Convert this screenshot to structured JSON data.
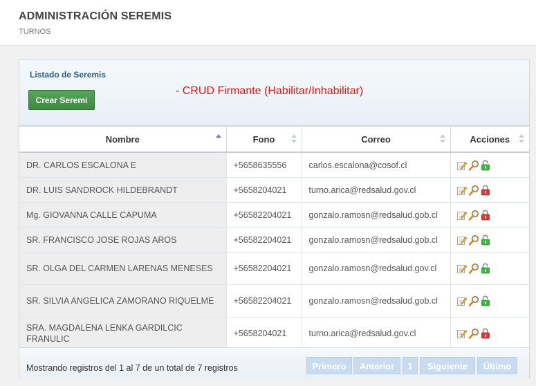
{
  "header": {
    "title": "ADMINISTRACIÓN SEREMIS",
    "subtitle": "TURNOS"
  },
  "panel": {
    "title": "Listado de Seremis",
    "create_button": "Crear Seremi",
    "annotation": "- CRUD Firmante (Habilitar/Inhabilitar)"
  },
  "table": {
    "columns": [
      "Nombre",
      "Fono",
      "Correo",
      "Acciones"
    ],
    "rows": [
      {
        "nombre": "DR. CARLOS ESCALONA E",
        "fono": "+5658635556",
        "correo": "carlos.escalona@cosof.cl",
        "lock": "enabled"
      },
      {
        "nombre": "DR. LUIS SANDROCK HILDEBRANDT",
        "fono": "+5658204021",
        "correo": "turno.arica@redsalud.gov.cl",
        "lock": "disabled"
      },
      {
        "nombre": "Mg. GIOVANNA CALLE CAPUMA",
        "fono": "+56582204021",
        "correo": "gonzalo.ramosn@redsalud.gob.cl",
        "lock": "disabled"
      },
      {
        "nombre": "SR. FRANCISCO JOSE ROJAS AROS",
        "fono": "+56582204021",
        "correo": "gonzalo.ramosn@redsalud.gob.cl",
        "lock": "enabled"
      },
      {
        "nombre": "SR. OLGA DEL CARMEN LARENAS MENESES",
        "fono": "+56582204021",
        "correo": "gonzalo.ramosn@redsalud.gov.cl",
        "lock": "enabled"
      },
      {
        "nombre": "SR. SILVIA ANGELICA ZAMORANO RIQUELME",
        "fono": "+56582204021",
        "correo": "gonzalo.ramosn@redsalud.gob.cl",
        "lock": "enabled"
      },
      {
        "nombre": "SRA. MAGDALENA LENKA GARDILCIC FRANULIC",
        "fono": "+5658204021",
        "correo": "turno.arica@redsalud.gov.cl",
        "lock": "disabled"
      }
    ]
  },
  "footer": {
    "info": "Mostrando registros del 1 al 7 de un total de 7 registros",
    "pager": {
      "first": "Primero",
      "prev": "Anterior",
      "page": "1",
      "next": "Siguiente",
      "last": "Último"
    }
  },
  "icons": {
    "edit": "edit-icon",
    "view": "magnifier-icon",
    "enabled": "unlocked-green-icon",
    "disabled": "locked-red-icon"
  },
  "colors": {
    "create_button": "#3e8a42",
    "annotation": "#e8120c",
    "pager": "#c9dbef",
    "lock_enabled": "#3db83d",
    "lock_disabled": "#d83a3a"
  }
}
